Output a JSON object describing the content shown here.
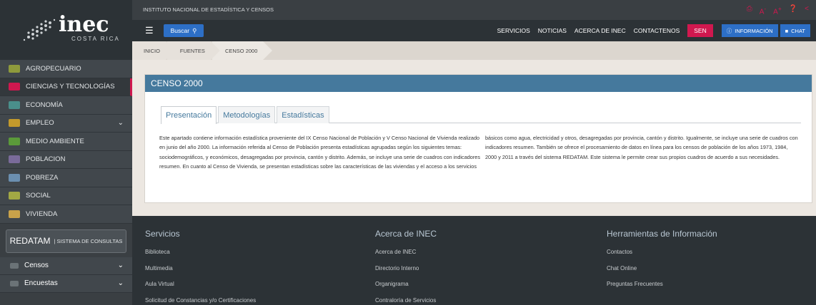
{
  "logo": {
    "text": "inec",
    "subtitle": "COSTA RICA"
  },
  "topbar": {
    "institution": "INSTITUTO NACIONAL DE ESTADÍSTICA Y CENSOS",
    "font_small": "A",
    "font_large": "A",
    "search_label": "Buscar",
    "links": [
      "SERVICIOS",
      "NOTICIAS",
      "ACERCA DE INEC",
      "CONTACTENOS"
    ],
    "sen_label": "SEN",
    "info_label": "INFORMACIÓN",
    "chat_label": "CHAT"
  },
  "breadcrumb": [
    "INICIO",
    "FUENTES",
    "CENSO 2000"
  ],
  "sidebar": {
    "items": [
      {
        "label": "AGROPECUARIO",
        "icon": "tractor-icon",
        "color": "#8e9a3c"
      },
      {
        "label": "CIENCIAS Y TECNOLOGÍAS",
        "icon": "flask-icon",
        "color": "#d0184f",
        "active": true
      },
      {
        "label": "ECONOMÍA",
        "icon": "money-icon",
        "color": "#4a8f8b"
      },
      {
        "label": "EMPLEO",
        "icon": "briefcase-icon",
        "color": "#c39a2c",
        "chevron": true
      },
      {
        "label": "MEDIO AMBIENTE",
        "icon": "leaf-icon",
        "color": "#5b9a3a"
      },
      {
        "label": "POBLACION",
        "icon": "people-icon",
        "color": "#7a6b9a"
      },
      {
        "label": "POBREZA",
        "icon": "hand-icon",
        "color": "#6b8fb0"
      },
      {
        "label": "SOCIAL",
        "icon": "group-icon",
        "color": "#a2a844"
      },
      {
        "label": "VIVIENDA",
        "icon": "house-icon",
        "color": "#c9a24a"
      }
    ],
    "redatam": {
      "title": "REDATAM",
      "subtitle": "| SISTEMA DE CONSULTAS"
    },
    "sub_items": [
      {
        "label": "Censos",
        "icon": "census-icon"
      },
      {
        "label": "Encuestas",
        "icon": "survey-icon"
      }
    ]
  },
  "content": {
    "title": "CENSO 2000",
    "tabs": [
      "Presentación",
      "Metodologías",
      "Estadísticas"
    ],
    "col1": "Este apartado contiene información estadística proveniente del IX Censo Nacional de Población y V Censo Nacional de Vivienda realizado en junio del año 2000. La información referida al Censo de Población presenta estadísticas agrupadas según los siguientes temas: sociodemográficos, y económicos, desagregadas por provincia, cantón y distrito. Además, se incluye una serie de cuadros con indicadores resumen. En cuanto al Censo de Vivienda, se presentan estadísticas sobre las características de las viviendas y el acceso a los servicios",
    "col2": "básicos como agua, electricidad y otros, desagregadas por provincia, cantón y distrito. Igualmente, se incluye una serie de cuadros con indicadores resumen. También se ofrece el procesamiento de datos en línea para los censos de población de los años 1973, 1984, 2000 y 2011 a través del sistema REDATAM. Este sistema le permite crear sus propios cuadros de acuerdo a sus necesidades."
  },
  "footer": {
    "columns": [
      {
        "title": "Servicios",
        "links": [
          "Biblioteca",
          "Multimedia",
          "Aula Virtual",
          "Solicitud de Constancias y/o Certificaciones"
        ]
      },
      {
        "title": "Acerca de INEC",
        "links": [
          "Acerca de INEC",
          "Directorio Interno",
          "Organigrama",
          "Contraloría de Servicios"
        ]
      },
      {
        "title": "Herramientas de Información",
        "links": [
          "Contactos",
          "Chat Online",
          "Preguntas Frecuentes"
        ]
      }
    ]
  },
  "colors": {
    "accent_red": "#d0184f",
    "accent_blue": "#2d6fc6",
    "header_blue": "#45799d",
    "dark": "#2c3236"
  }
}
